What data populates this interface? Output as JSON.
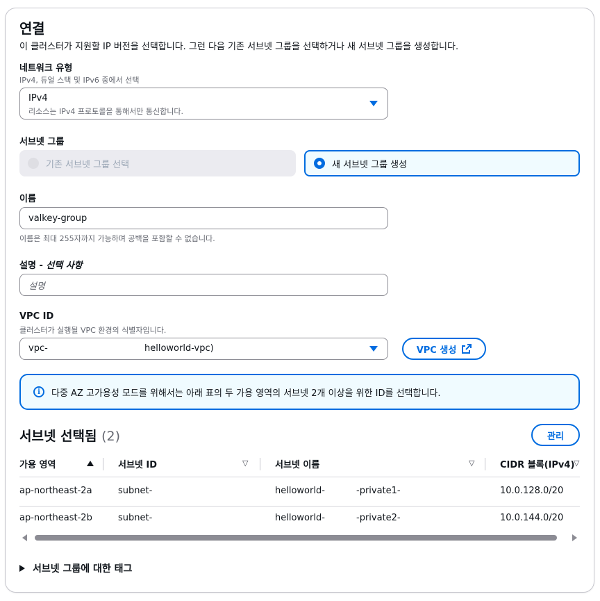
{
  "connection": {
    "title": "연결",
    "description": "이 클러스터가 지원할 IP 버전을 선택합니다. 그런 다음 기존 서브넷 그룹을 선택하거나 새 서브넷 그룹을 생성합니다."
  },
  "network_type": {
    "label": "네트워크 유형",
    "hint": "IPv4, 듀얼 스택 및 IPv6 중에서 선택",
    "selected": "IPv4",
    "selected_desc": "리소스는 IPv4 프로토콜을 통해서만 통신합니다."
  },
  "subnet_group": {
    "label": "서브넷 그룹",
    "option_existing": "기존 서브넷 그룹 선택",
    "option_new": "새 서브넷 그룹 생성"
  },
  "name": {
    "label": "이름",
    "value": "valkey-group",
    "hint": "이름은 최대 255자까지 가능하며 공백을 포함할 수 없습니다."
  },
  "description_field": {
    "label": "설명",
    "label_optional": "선택 사항",
    "placeholder": "설명"
  },
  "vpc": {
    "label": "VPC ID",
    "hint": "클러스터가 실행될 VPC 환경의 식별자입니다.",
    "value_prefix": "vpc-",
    "value_suffix": "helloworld-vpc)",
    "create_button": "VPC 생성"
  },
  "alert": {
    "text": "다중 AZ 고가용성 모드를 위해서는 아래 표의 두 가용 영역의 서브넷 2개 이상을 위한 ID를 선택합니다."
  },
  "subnets_selected": {
    "title": "서브넷 선택됨",
    "count": "(2)",
    "manage_button": "관리",
    "columns": [
      "가용 영역",
      "서브넷 ID",
      "서브넷 이름",
      "CIDR 블록(IPv4)"
    ],
    "rows": [
      {
        "az": "ap-northeast-2a",
        "subnet_id": "subnet-",
        "name_a": "helloworld-",
        "name_b": "-private1-",
        "cidr": "10.0.128.0/20"
      },
      {
        "az": "ap-northeast-2b",
        "subnet_id": "subnet-",
        "name_a": "helloworld-",
        "name_b": "-private2-",
        "cidr": "10.0.144.0/20"
      }
    ]
  },
  "tags_section": {
    "title": "서브넷 그룹에 대한 태그"
  },
  "colors": {
    "accent": "#006ce0",
    "border": "#8c8c94",
    "text": "#0f141a",
    "muted": "#656871"
  }
}
